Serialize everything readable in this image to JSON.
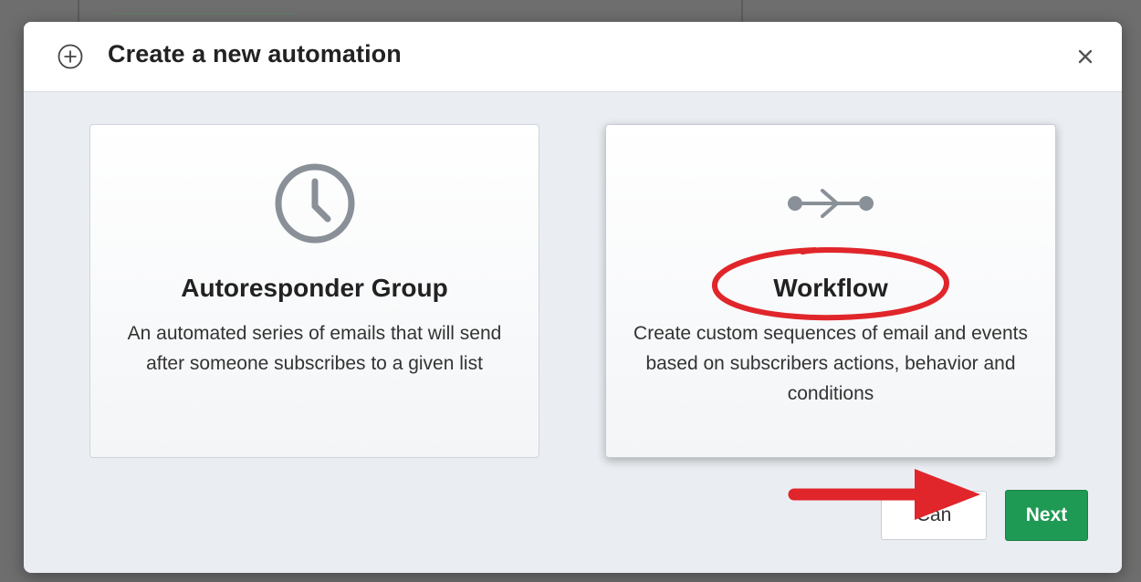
{
  "modal": {
    "title": "Create a new automation",
    "header_icon": "plus-circle-icon",
    "close_label": "×"
  },
  "options": [
    {
      "title": "Autoresponder Group",
      "description": "An automated series of emails that will send after someone subscribes to a given list",
      "icon": "clock-icon"
    },
    {
      "title": "Workflow",
      "description": "Create custom sequences of email and events based on subscribers actions, behavior and conditions",
      "icon": "workflow-icon"
    }
  ],
  "footer": {
    "cancel_label": "Can",
    "next_label": "Next"
  },
  "colors": {
    "next_button": "#1f9a55",
    "annotation_red": "#e0262b",
    "icon_gray": "#8a9097"
  }
}
